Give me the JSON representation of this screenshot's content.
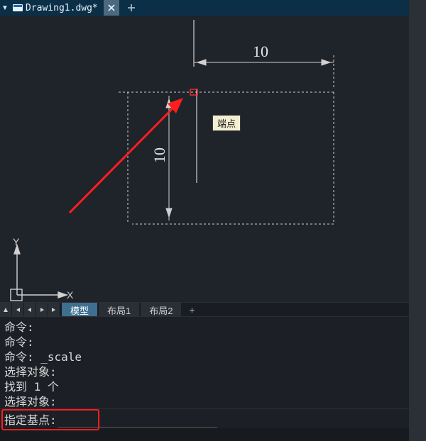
{
  "tabs": {
    "file_name": "Drawing1.dwg*",
    "toggle_glyph": "▼"
  },
  "drawing": {
    "dim_top": "10",
    "dim_left": "10",
    "axis_x": "X",
    "axis_y": "Y",
    "snap_tooltip": "端点"
  },
  "layout_tabs": {
    "items": [
      {
        "label": "模型",
        "active": true
      },
      {
        "label": "布局1",
        "active": false
      },
      {
        "label": "布局2",
        "active": false
      }
    ],
    "add_glyph": "+"
  },
  "command_history": [
    "命令:",
    "命令:",
    "命令: _scale",
    "选择对象:",
    "找到 1 个",
    "选择对象:"
  ],
  "command_bar": {
    "prompt": "指定基点:",
    "value": ""
  }
}
